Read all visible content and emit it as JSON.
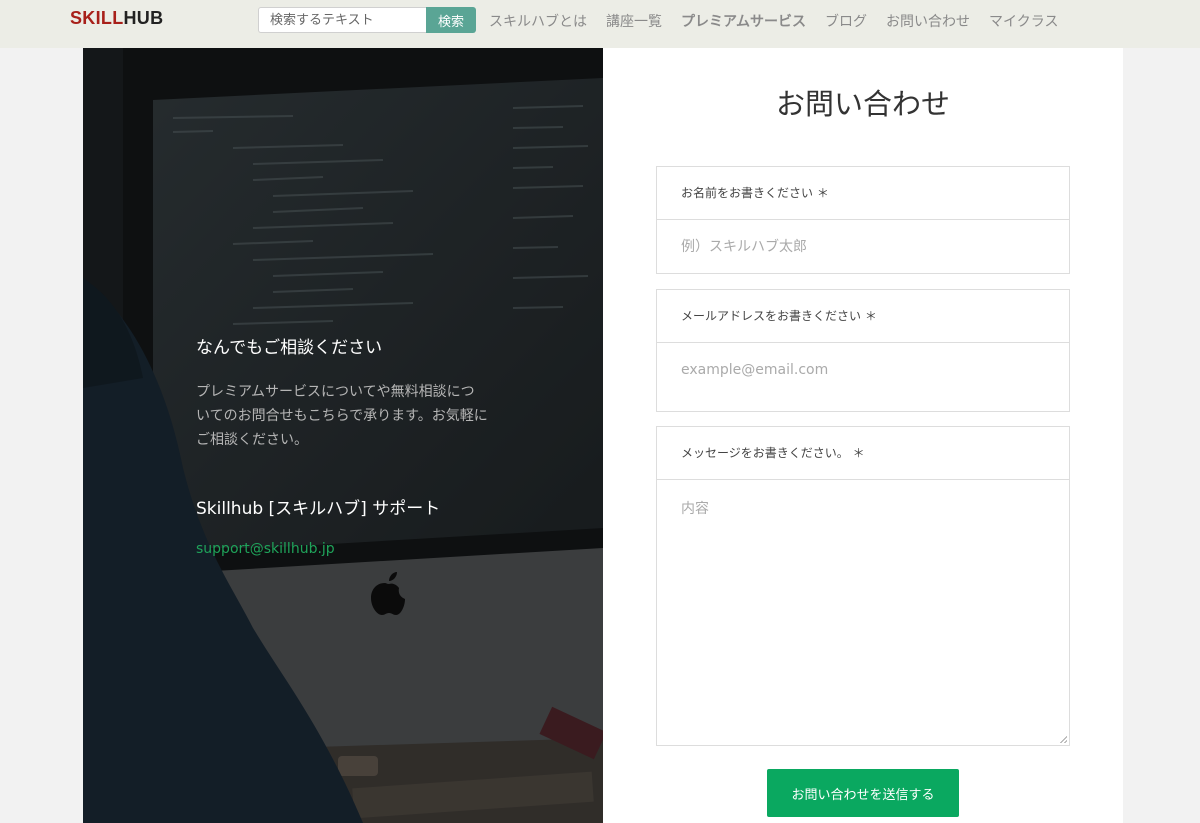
{
  "header": {
    "logo_part1": "SKILL",
    "logo_part2": "HUB",
    "search_placeholder": "検索するテキスト",
    "search_button": "検索",
    "nav": [
      {
        "label": "スキルハブとは"
      },
      {
        "label": "講座一覧"
      },
      {
        "label": "プレミアムサービス"
      },
      {
        "label": "ブログ"
      },
      {
        "label": "お問い合わせ"
      },
      {
        "label": "マイクラス"
      }
    ]
  },
  "hero": {
    "heading": "なんでもご相談ください",
    "body": "プレミアムサービスについてや無料相談についてのお問合せもこちらで承ります。お気軽にご相談ください。",
    "support_title": "Skillhub [スキルハブ] サポート",
    "email": "support@skillhub.jp"
  },
  "form": {
    "title": "お問い合わせ",
    "name_label": "お名前をお書きください ＊",
    "name_placeholder": "例）スキルハブ太郎",
    "email_label": "メールアドレスをお書きください ＊",
    "email_placeholder": "example@email.com",
    "message_label": "メッセージをお書きください。 ＊",
    "message_placeholder": "内容",
    "submit": "お問い合わせを送信する"
  },
  "colors": {
    "header_bg": "#ecede6",
    "logo_red": "#a8201a",
    "search_button": "#5aa595",
    "email_link": "#1fa35a",
    "submit_button": "#0aa860"
  }
}
